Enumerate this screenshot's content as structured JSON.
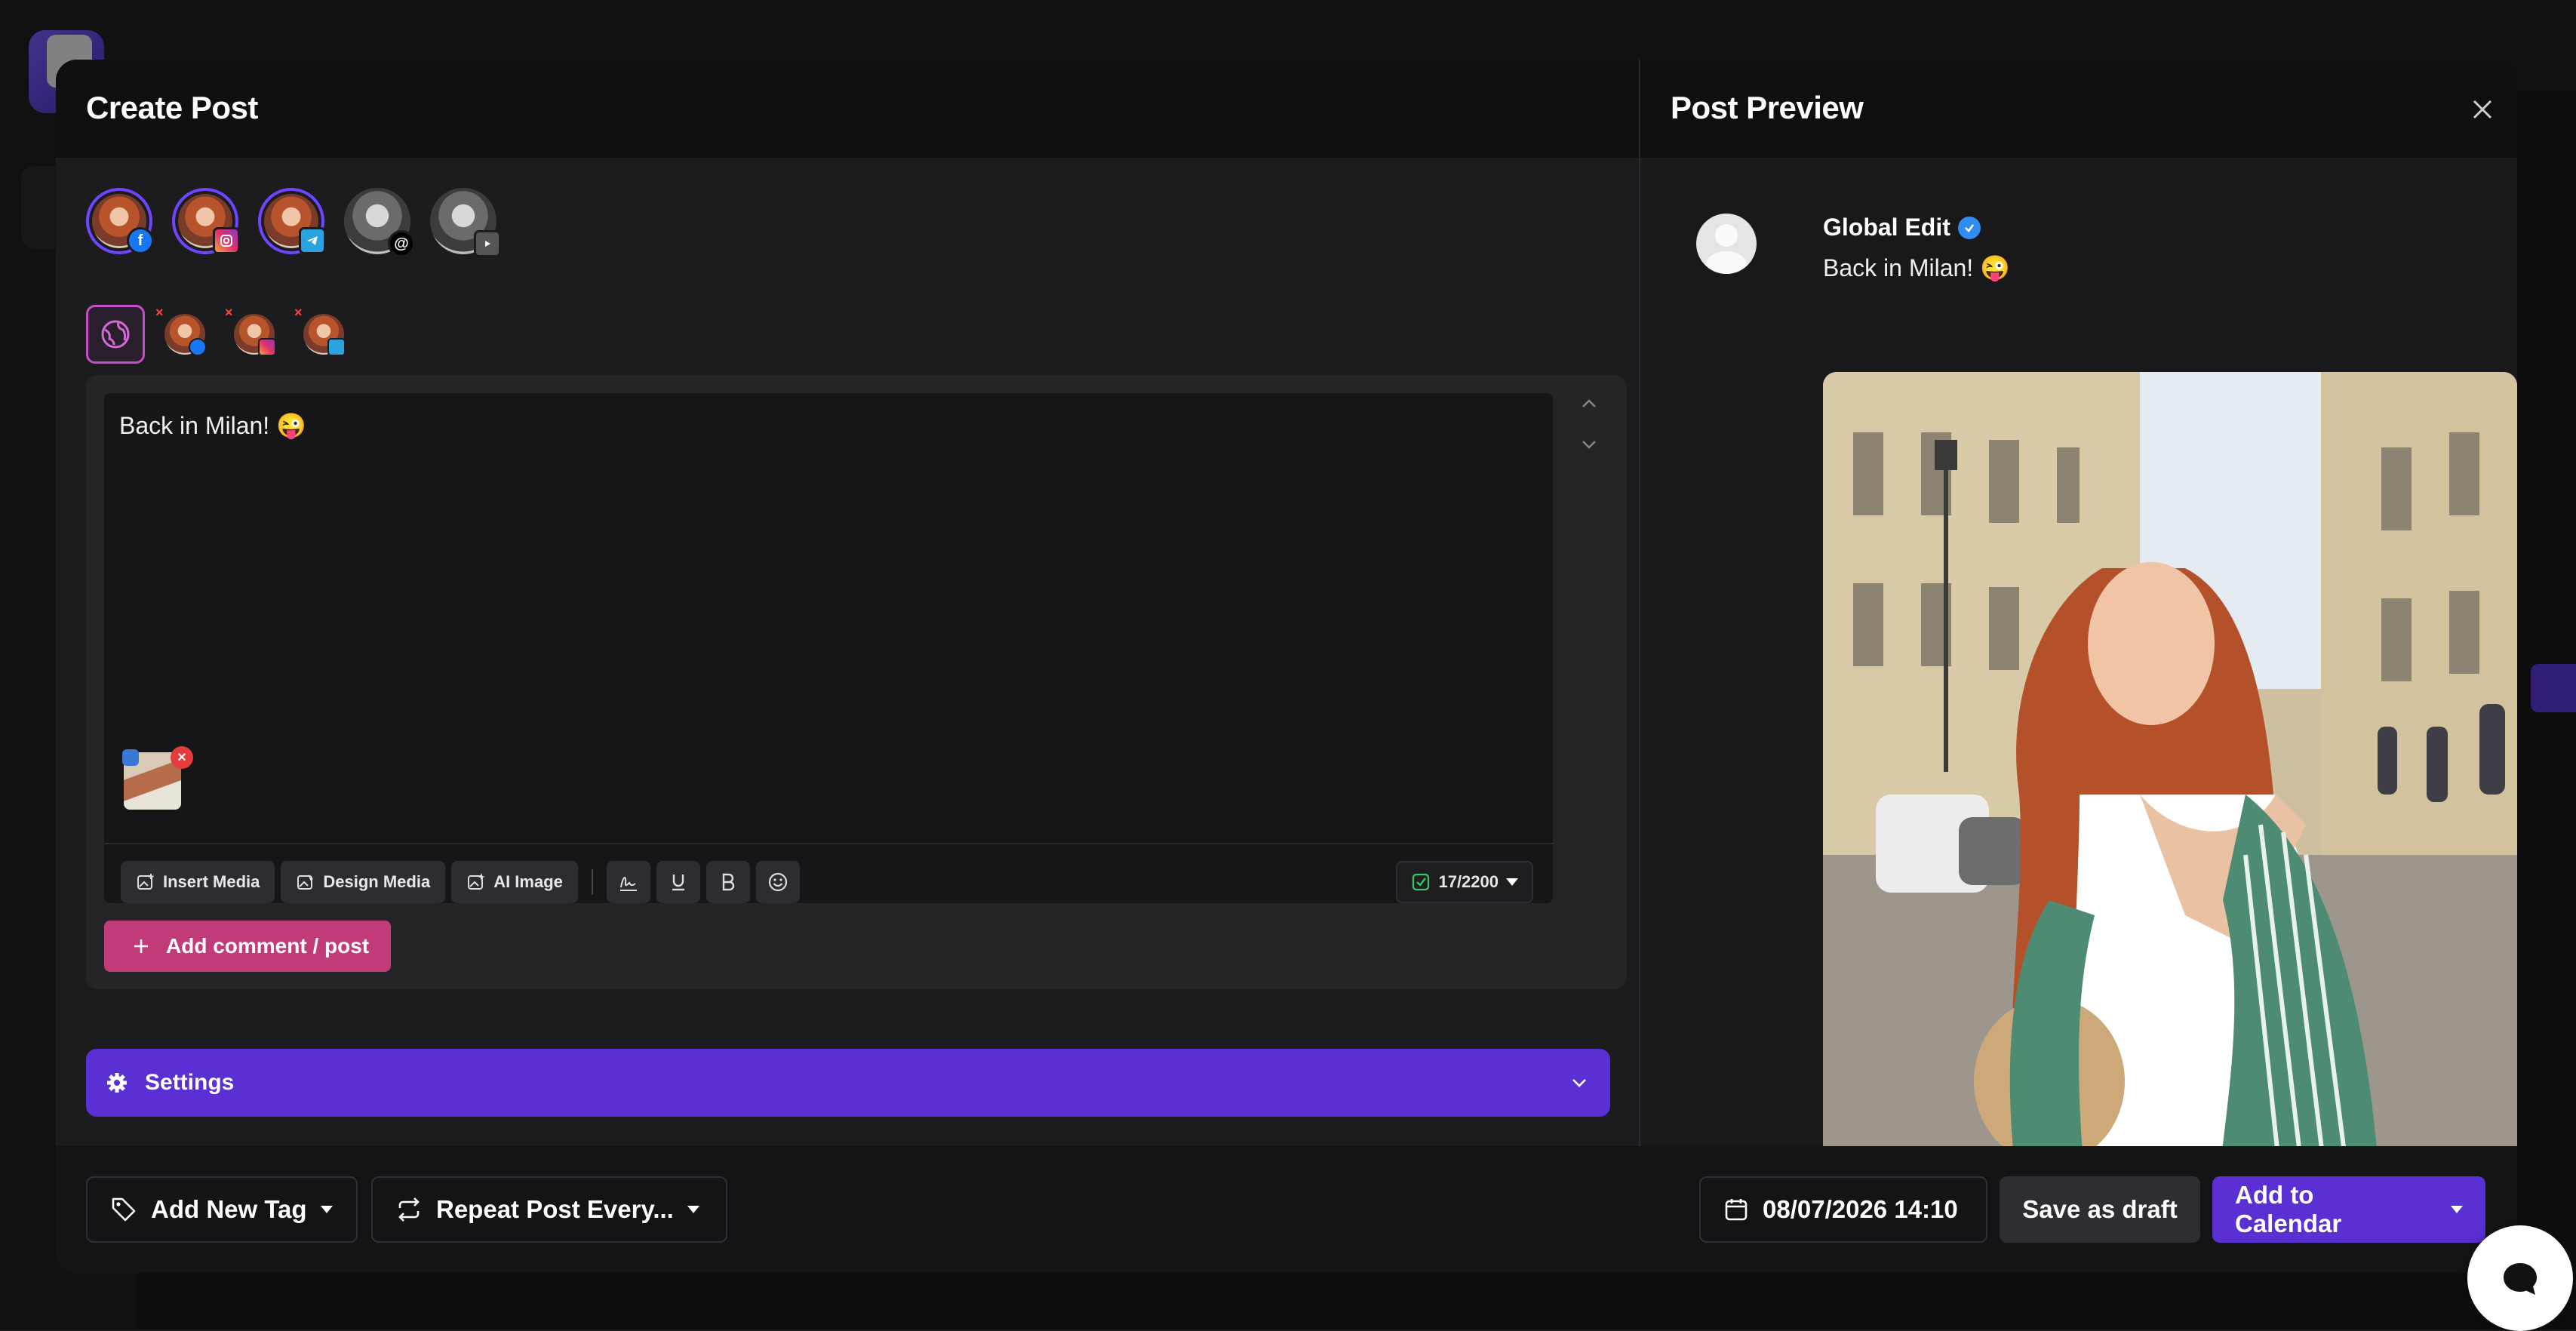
{
  "create_post": {
    "title": "Create Post",
    "accounts": [
      {
        "name": "facebook-account",
        "platform": "facebook",
        "selected": true
      },
      {
        "name": "instagram-account",
        "platform": "instagram",
        "selected": true
      },
      {
        "name": "telegram-account",
        "platform": "telegram",
        "selected": true
      },
      {
        "name": "threads-account",
        "platform": "threads",
        "selected": false
      },
      {
        "name": "youtube-account",
        "platform": "youtube",
        "selected": false
      }
    ],
    "editor": {
      "text": "Back in Milan! 😜",
      "char_count": "17/2200",
      "toolbar": {
        "insert_media": "Insert Media",
        "design_media": "Design Media",
        "ai_image": "AI Image"
      },
      "add_comment": "Add comment / post"
    },
    "settings": {
      "label": "Settings"
    }
  },
  "footer": {
    "add_tag": "Add New Tag",
    "repeat_post": "Repeat Post Every...",
    "datetime": "08/07/2026 14:10",
    "save_draft": "Save as draft",
    "add_calendar": "Add to Calendar"
  },
  "preview": {
    "title": "Post Preview",
    "account_name": "Global Edit",
    "post_text": "Back in Milan! 😜"
  },
  "colors": {
    "accent_purple": "#5a2fd4",
    "accent_pink": "#c23b79",
    "verified_blue": "#2f8cf0"
  }
}
